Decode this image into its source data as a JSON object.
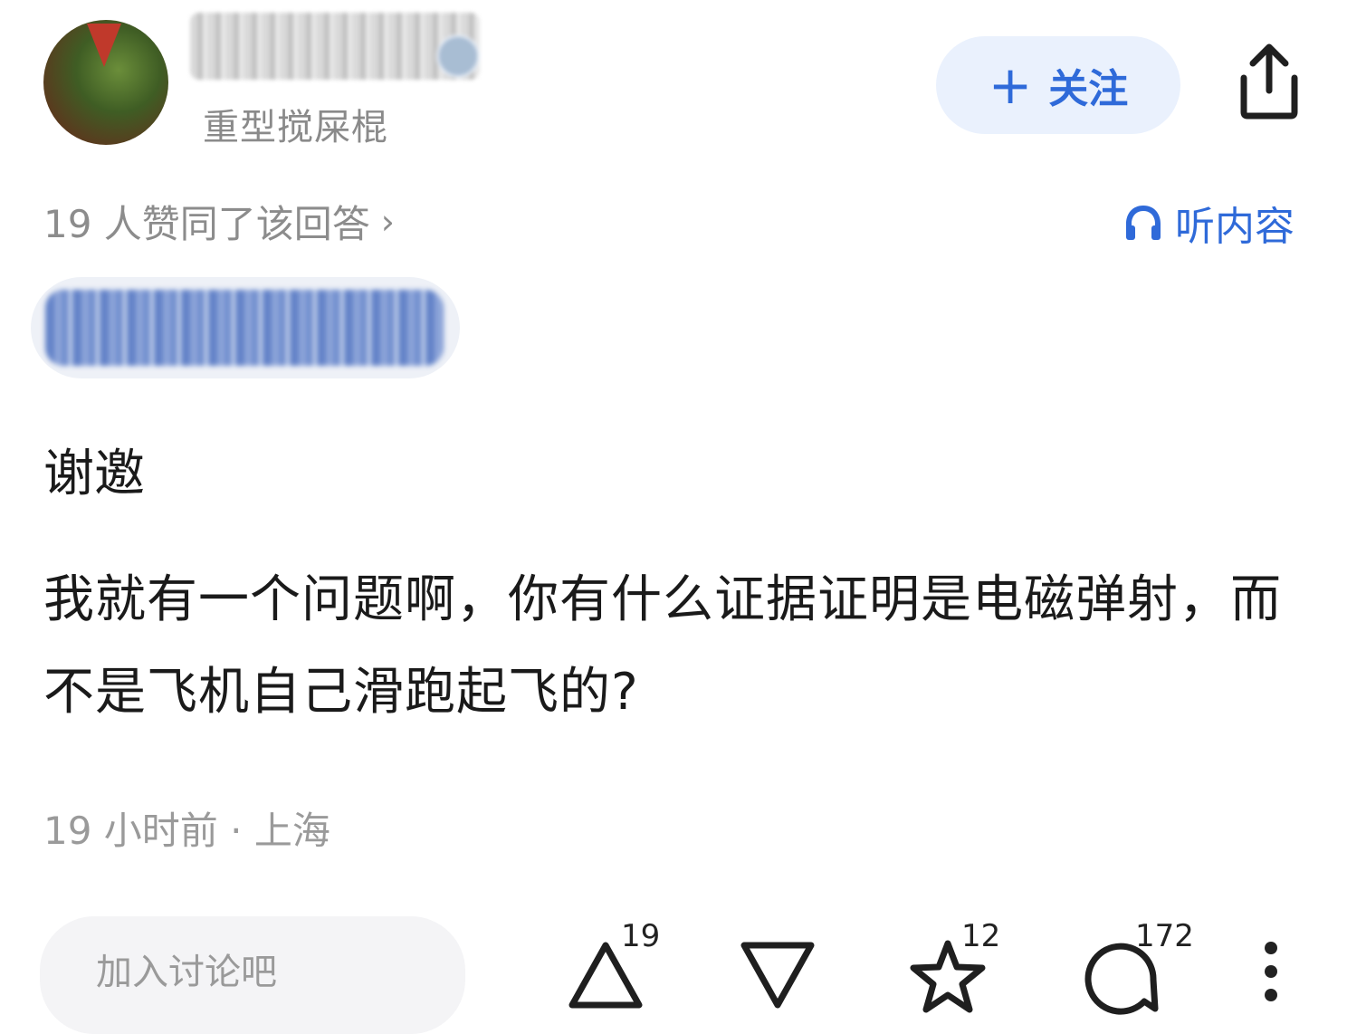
{
  "author": {
    "username": "重型搅屎棍",
    "avatar": "avatar-image"
  },
  "header": {
    "follow_label": "关注",
    "follow_icon": "plus-icon",
    "share_icon": "share-icon"
  },
  "answer": {
    "vote_summary": "19 人赞同了该回答",
    "vote_summary_chevron": "›",
    "listen_label": "听内容",
    "listen_icon": "headphones-icon",
    "paragraphs": [
      "谢邀",
      "我就有一个问题啊，你有什么证据证明是电磁弹射，而不是飞机自己滑跑起飞的?"
    ],
    "meta": "19 小时前 · 上海"
  },
  "footer": {
    "comment_placeholder": "加入讨论吧",
    "upvote_count": "19",
    "favorite_count": "12",
    "comment_count": "172",
    "icons": [
      "upvote-icon",
      "downvote-icon",
      "star-icon",
      "comment-icon",
      "more-icon"
    ]
  },
  "colors": {
    "accent": "#2f6ad9",
    "follow_bg": "#eaf1fd",
    "muted_text": "#8c8c8c",
    "body_text": "#1a1a1a"
  }
}
